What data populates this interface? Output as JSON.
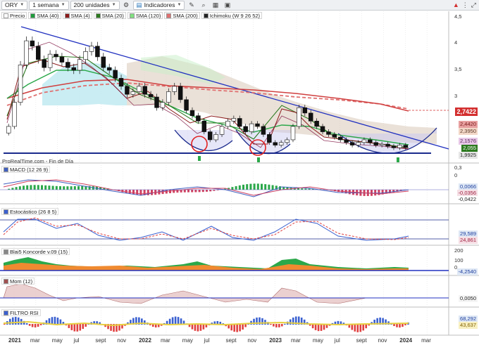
{
  "toolbar": {
    "symbol": "ORY",
    "timeframe": "1 semana",
    "units": "200 unidades",
    "indicators": "Indicadores"
  },
  "legend": [
    {
      "label": "Precio",
      "color": "#ffffff"
    },
    {
      "label": "SMA (40)",
      "color": "#1e9c3c"
    },
    {
      "label": "SMA (4)",
      "color": "#8c1a1a"
    },
    {
      "label": "SMA (20)",
      "color": "#2c7a1f"
    },
    {
      "label": "SMA (120)",
      "color": "#7fe07f"
    },
    {
      "label": "SMA (200)",
      "color": "#e07070"
    },
    {
      "label": "Ichimoku (W 9 26 52)",
      "color": "#222222"
    }
  ],
  "watermark": "ProRealTime.com - Fin de Día",
  "price_axis": [
    "4,5",
    "4",
    "3,5",
    "3"
  ],
  "price_tags": [
    {
      "value": "2,7422",
      "color": "#d32f2f",
      "text_color": "#ffffff"
    },
    {
      "value": "2,4420",
      "color": "#e8a0a0",
      "text_color": "#7a1a1a"
    },
    {
      "value": "2,3950",
      "color": "#f3d8c8",
      "text_color": "#5a3a2a"
    },
    {
      "value": "2,1576",
      "color": "#e8c8e8",
      "text_color": "#5a2a5a"
    },
    {
      "value": "2,055",
      "color": "#2c7a1f",
      "text_color": "#ffffff"
    },
    {
      "value": "1,9925",
      "color": "#e6e6e6",
      "text_color": "#222222"
    }
  ],
  "panes": {
    "macd": {
      "label": "MACD (12 26 9)",
      "axis": [
        "0,3",
        "0"
      ],
      "tags": [
        "0,0066",
        "-0,0356",
        "-0,0422"
      ]
    },
    "stoch": {
      "label": "Estocástico (26 8 5)",
      "tags": [
        "29,589",
        "24,861"
      ]
    },
    "koncorde": {
      "label": "Blai5 Koncorde v.09 (15)",
      "axis": [
        "200",
        "100",
        "0"
      ],
      "tags": [
        "-4,2540"
      ]
    },
    "mom": {
      "label": "Mom (12)",
      "tags": [
        "0,0050"
      ]
    },
    "rsi": {
      "label": "FILTRO RSI",
      "tags": [
        "68,292",
        "43,637"
      ]
    }
  },
  "time_axis": [
    "2021",
    "mar",
    "may",
    "jul",
    "sept",
    "nov",
    "2022",
    "mar",
    "may",
    "jul",
    "sept",
    "nov",
    "2023",
    "mar",
    "may",
    "jul",
    "sept",
    "nov",
    "2024",
    "mar"
  ],
  "chart_data": {
    "type": "candlestick",
    "title": "ORY",
    "period": "1 semana",
    "ylim": [
      1.95,
      4.55
    ],
    "last_price": 2.055,
    "closes": [
      2.45,
      2.9,
      3.6,
      4.05,
      3.95,
      3.7,
      3.55,
      3.8,
      3.75,
      3.65,
      3.55,
      3.5,
      3.7,
      3.85,
      3.95,
      3.75,
      3.55,
      3.5,
      3.35,
      3.2,
      3.05,
      3.1,
      3.2,
      3.05,
      3.0,
      2.8,
      2.9,
      3.1,
      3.2,
      2.95,
      2.75,
      2.65,
      2.55,
      2.35,
      2.2,
      2.3,
      2.45,
      2.55,
      2.6,
      2.45,
      2.35,
      2.5,
      2.45,
      2.3,
      2.15,
      2.1,
      2.15,
      2.2,
      2.45,
      2.8,
      2.7,
      2.55,
      2.45,
      2.35,
      2.3,
      2.25,
      2.2,
      2.15,
      2.1,
      2.15,
      2.2,
      2.15,
      2.1,
      2.12,
      2.08,
      2.05,
      2.1,
      2.055
    ],
    "trendline": {
      "from": 4.35,
      "to": 2.0
    },
    "support": 1.9925
  }
}
